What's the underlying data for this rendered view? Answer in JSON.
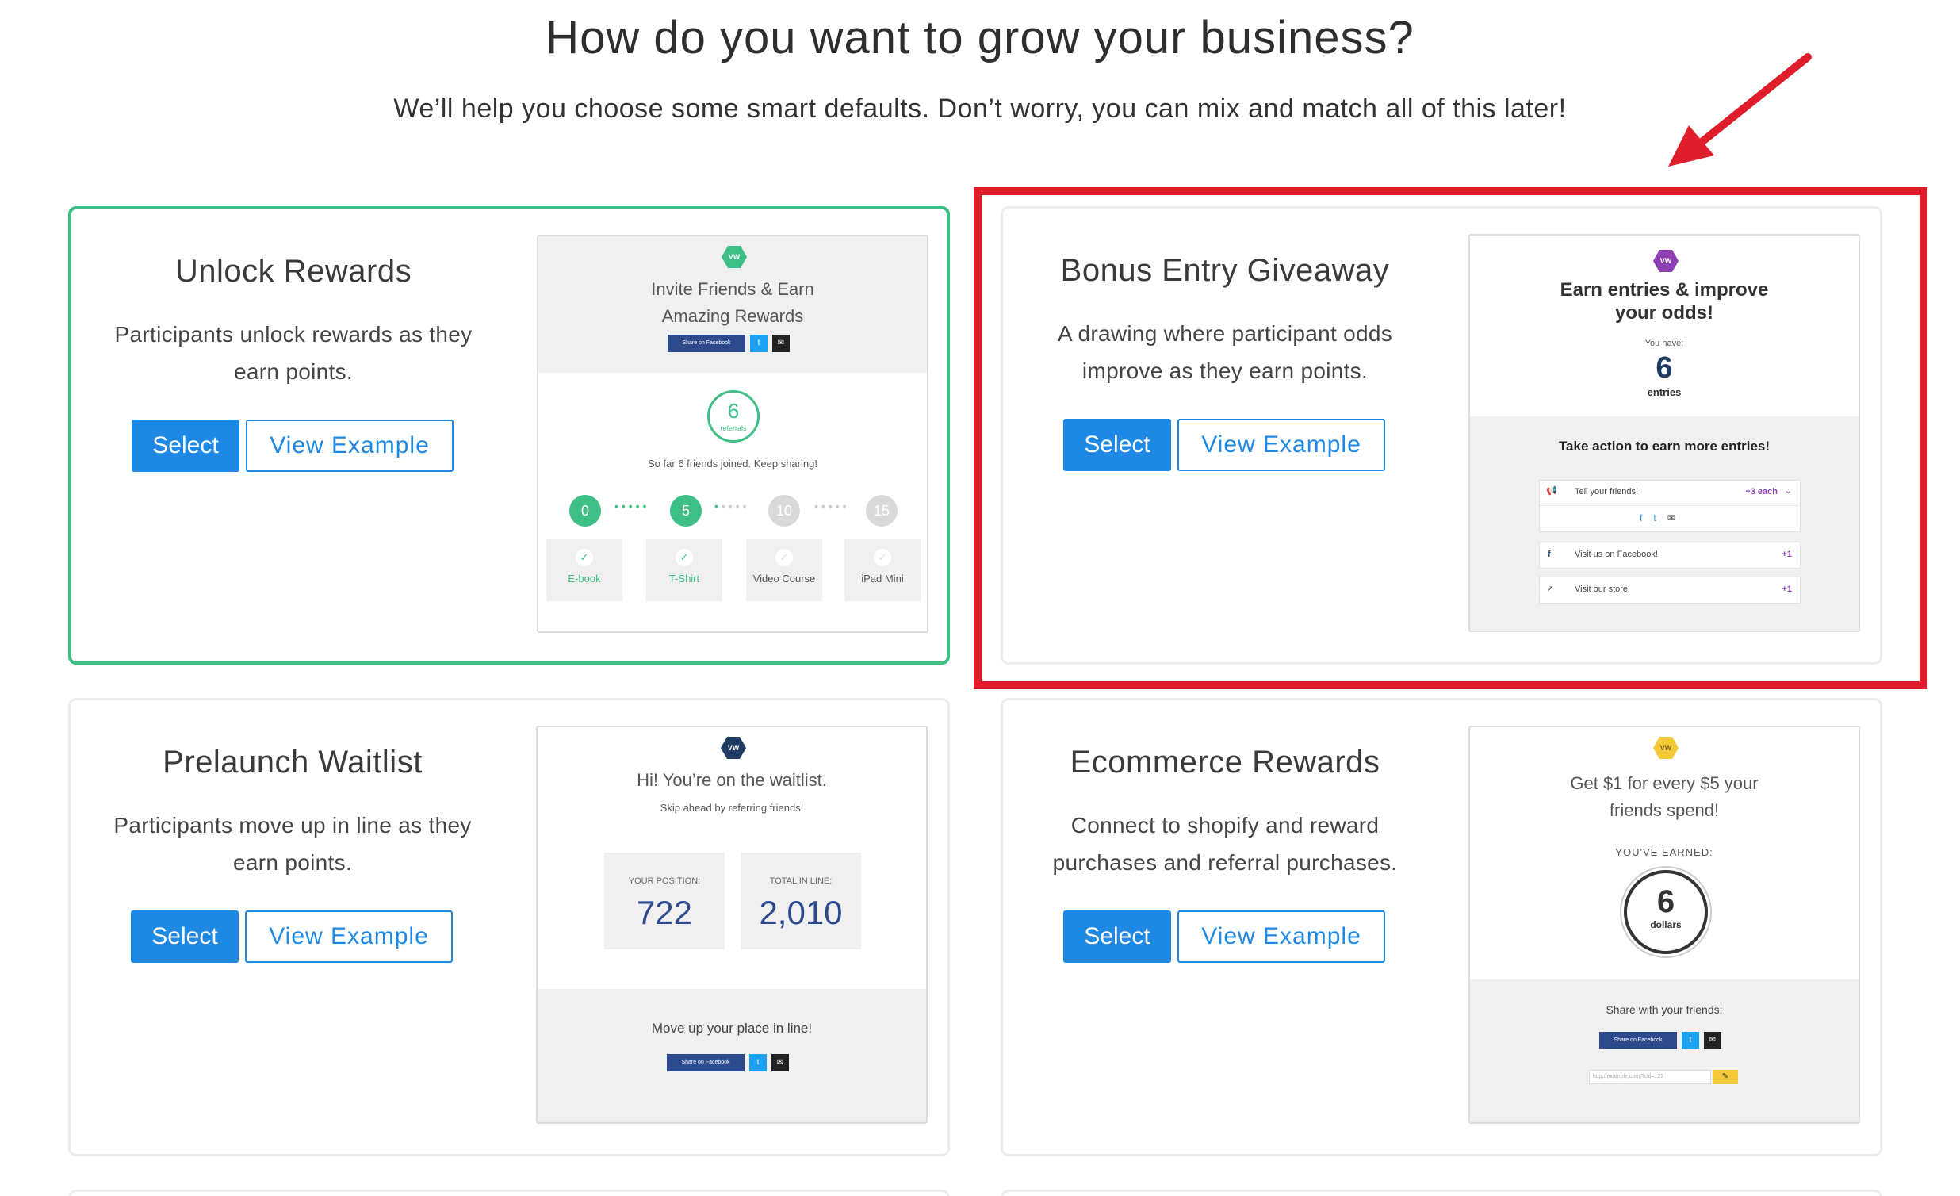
{
  "header": {
    "title": "How do you want to grow your business?",
    "subtitle": "We’ll help you choose some smart defaults. Don’t worry, you can mix and match all of this later!"
  },
  "buttons": {
    "select": "Select",
    "view_example": "View Example"
  },
  "cards": [
    {
      "title": "Unlock Rewards",
      "description": "Participants unlock rewards as they earn points.",
      "selected": true,
      "preview": {
        "logo": "VW",
        "headline": "Invite Friends & Earn Amazing Rewards",
        "share_facebook": "Share on Facebook",
        "count": "6",
        "count_unit": "referrals",
        "status": "So far 6 friends joined. Keep sharing!",
        "milestones": [
          {
            "value": "0",
            "reward": "E-book",
            "reached": true
          },
          {
            "value": "5",
            "reward": "T-Shirt",
            "reached": true
          },
          {
            "value": "10",
            "reward": "Video Course",
            "reached": false
          },
          {
            "value": "15",
            "reward": "iPad Mini",
            "reached": false
          }
        ]
      }
    },
    {
      "title": "Bonus Entry Giveaway",
      "description": "A drawing where participant odds improve as they earn points.",
      "selected": false,
      "highlighted": true,
      "preview": {
        "logo": "VW",
        "headline": "Earn entries & improve your odds!",
        "you_have": "You have:",
        "count": "6",
        "count_unit": "entries",
        "action_title": "Take action to earn more entries!",
        "actions": [
          {
            "label": "Tell your friends!",
            "bonus": "+3 each"
          },
          {
            "label": "Visit us on Facebook!",
            "bonus": "+1"
          },
          {
            "label": "Visit our store!",
            "bonus": "+1"
          }
        ]
      }
    },
    {
      "title": "Prelaunch Waitlist",
      "description": "Participants move up in line as they earn points.",
      "selected": false,
      "preview": {
        "logo": "VW",
        "headline": "Hi! You’re on the waitlist.",
        "subline": "Skip ahead by referring friends!",
        "position_label": "YOUR POSITION:",
        "position": "722",
        "total_label": "TOTAL IN LINE:",
        "total": "2,010",
        "footer": "Move up your place in line!",
        "share_facebook": "Share on Facebook"
      }
    },
    {
      "title": "Ecommerce Rewards",
      "description": "Connect to shopify and reward purchases and referral purchases.",
      "selected": false,
      "preview": {
        "logo": "VW",
        "headline": "Get $1 for every $5 your friends spend!",
        "earned_label": "YOU'VE EARNED:",
        "count": "6",
        "count_unit": "dollars",
        "share_label": "Share with your friends:",
        "share_facebook": "Share on Facebook",
        "link_placeholder": "http://example.com?lcid=123"
      }
    }
  ],
  "colors": {
    "primary": "#1e88e5",
    "selected_border": "#3dbf86",
    "annotation_red": "#e01e2b"
  }
}
